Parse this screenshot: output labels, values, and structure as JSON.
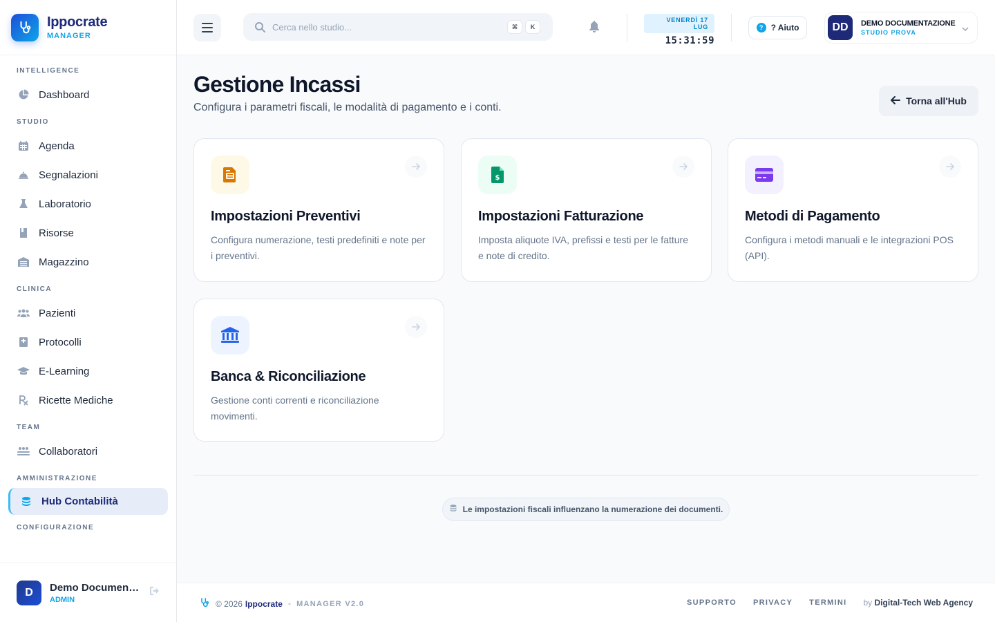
{
  "brand": {
    "name": "Ippocrate",
    "sub": "MANAGER"
  },
  "sidebar": {
    "sections": [
      {
        "title": "INTELLIGENCE",
        "items": [
          {
            "label": "Dashboard",
            "icon": "pie-chart-icon"
          }
        ]
      },
      {
        "title": "STUDIO",
        "items": [
          {
            "label": "Agenda",
            "icon": "calendar-icon"
          },
          {
            "label": "Segnalazioni",
            "icon": "bell-service-icon"
          },
          {
            "label": "Laboratorio",
            "icon": "flask-icon"
          },
          {
            "label": "Risorse",
            "icon": "book-icon"
          },
          {
            "label": "Magazzino",
            "icon": "warehouse-icon"
          }
        ]
      },
      {
        "title": "CLINICA",
        "items": [
          {
            "label": "Pazienti",
            "icon": "users-icon"
          },
          {
            "label": "Protocolli",
            "icon": "medical-book-icon"
          },
          {
            "label": "E-Learning",
            "icon": "graduation-cap-icon"
          },
          {
            "label": "Ricette Mediche",
            "icon": "prescription-icon"
          }
        ]
      },
      {
        "title": "TEAM",
        "items": [
          {
            "label": "Collaboratori",
            "icon": "team-icon"
          }
        ]
      },
      {
        "title": "AMMINISTRAZIONE",
        "items": [
          {
            "label": "Hub Contabilità",
            "icon": "coins-icon",
            "active": true
          }
        ]
      },
      {
        "title": "CONFIGURAZIONE",
        "items": []
      }
    ],
    "user": {
      "initial": "D",
      "name": "Demo Documenta...",
      "role": "ADMIN"
    }
  },
  "header": {
    "search_placeholder": "Cerca nello studio...",
    "kbd": [
      "⌘",
      "K"
    ],
    "date": "VENERDÌ 17 LUG",
    "time": "15:31:59",
    "help_label": "? Aiuto",
    "profile": {
      "initials": "DD",
      "name": "DEMO DOCUMENTAZIONE",
      "studio": "STUDIO PROVA"
    }
  },
  "page": {
    "title": "Gestione Incassi",
    "subtitle": "Configura i parametri fiscali, le modalità di pagamento e i conti.",
    "back_label": "Torna all'Hub",
    "cards": [
      {
        "title": "Impostazioni Preventivi",
        "desc": "Configura numerazione, testi predefiniti e note per i preventivi.",
        "icon": "quote-document-icon",
        "color": "#d97706",
        "bg": "#fef9e7"
      },
      {
        "title": "Impostazioni Fatturazione",
        "desc": "Imposta aliquote IVA, prefissi e testi per le fatture e note di credito.",
        "icon": "invoice-dollar-icon",
        "color": "#059669",
        "bg": "#ecfdf5"
      },
      {
        "title": "Metodi di Pagamento",
        "desc": "Configura i metodi manuali e le integrazioni POS (API).",
        "icon": "credit-card-icon",
        "color": "#7c3aed",
        "bg": "#f3f0ff"
      },
      {
        "title": "Banca & Riconciliazione",
        "desc": "Gestione conti correnti e riconciliazione movimenti.",
        "icon": "bank-icon",
        "color": "#2563eb",
        "bg": "#eef4ff"
      }
    ],
    "notice": "Le impostazioni fiscali influenzano la numerazione dei documenti."
  },
  "footer": {
    "copyright": "© 2026",
    "brand": "Ippocrate",
    "version": "MANAGER V2.0",
    "links": [
      "SUPPORTO",
      "PRIVACY",
      "TERMINI"
    ],
    "by_prefix": "by",
    "agency": "Digital-Tech Web Agency"
  }
}
